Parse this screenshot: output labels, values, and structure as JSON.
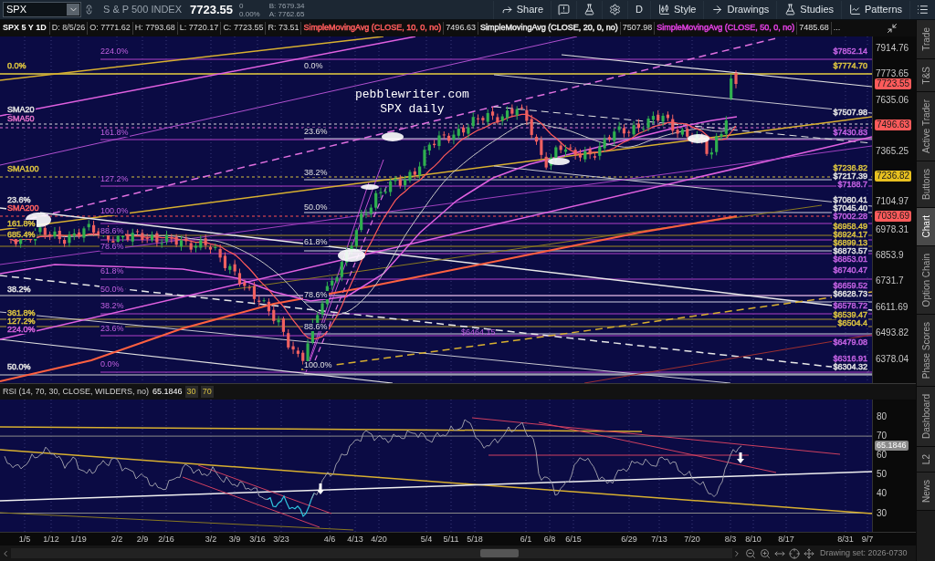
{
  "toolbar": {
    "symbol": "SPX",
    "description": "S & P 500 INDEX",
    "last": "7723.55",
    "change": "0",
    "change_pct": "0.00%",
    "bid": "B: 7679.34",
    "ask": "A: 7762.65",
    "buttons": [
      {
        "kind": "share",
        "label": "Share"
      },
      {
        "kind": "alert"
      },
      {
        "kind": "flask"
      },
      {
        "kind": "gear"
      },
      {
        "kind": "period",
        "label": "D"
      },
      {
        "kind": "style",
        "label": "Style"
      },
      {
        "kind": "drawings",
        "label": "Drawings"
      },
      {
        "kind": "studies",
        "label": "Studies"
      },
      {
        "kind": "patterns",
        "label": "Patterns"
      },
      {
        "kind": "menu"
      }
    ]
  },
  "chart_header": {
    "title": "SPX 5 Y 1D",
    "fields": [
      "D: 8/5/26",
      "O: 7771.62",
      "H: 7793.68",
      "L: 7720.17",
      "C: 7723.55",
      "R: 73.51"
    ],
    "studies": [
      {
        "name": "SimpleMovingAvg (CLOSE, 10, 0, no)",
        "value": "7496.63",
        "color": "#ff5c5c"
      },
      {
        "name": "SimpleMovingAvg (CLOSE, 20, 0, no)",
        "value": "7507.98",
        "color": "#e8e8e8"
      },
      {
        "name": "SimpleMovingAvg (CLOSE, 50, 0, no)",
        "value": "7485.68",
        "color": "#e040e0"
      }
    ],
    "more": "..."
  },
  "price_chart": {
    "note": [
      "pebblewriter.com",
      "SPX daily"
    ],
    "left_labels": [
      {
        "label": "0.0%",
        "color": "#d8c040"
      },
      {
        "label": "SMA20",
        "color": "#e0e0e0"
      },
      {
        "label": "SMA50",
        "color": "#e070c8"
      },
      {
        "label": "SMA100",
        "color": "#d8c040"
      },
      {
        "label": "23.6%",
        "color": "#e0e0e0"
      },
      {
        "label": "SMA200",
        "color": "#ff6060"
      },
      {
        "label": "161.8%",
        "color": "#d8c040"
      },
      {
        "label": "685.4%",
        "color": "#d8c040"
      },
      {
        "label": "38.2%",
        "color": "#e0e0e0"
      },
      {
        "label": "361.8%",
        "color": "#d8c040"
      },
      {
        "label": "127.2%",
        "color": "#d8c040"
      },
      {
        "label": "224.0%",
        "color": "#d060d8"
      },
      {
        "label": "50.0%",
        "color": "#e0e0e0"
      }
    ],
    "extension_labels": [
      "224.0%",
      "161.8%",
      "127.2%",
      "100.0%",
      "88.6%",
      "78.6%",
      "61.8%",
      "50.0%",
      "38.2%",
      "23.6%",
      "0.0%"
    ],
    "retracement_labels": [
      "0.0%",
      "23.6%",
      "38.2%",
      "50.0%",
      "61.8%",
      "78.6%",
      "88.6%",
      "100.0%"
    ],
    "mid_level_label": "$6464.15",
    "level_labels": [
      {
        "label": "$7852.14",
        "color": "#c060e0"
      },
      {
        "label": "$7774.70",
        "color": "#d8c040"
      },
      {
        "label": "$7507.98",
        "color": "#e0e0e0"
      },
      {
        "label": "$7430.83",
        "color": "#c060e0"
      },
      {
        "label": "$7236.82",
        "color": "#d8c040"
      },
      {
        "label": "$7217.39",
        "color": "#e0e0e0"
      },
      {
        "label": "$7188.7",
        "color": "#c060e0"
      },
      {
        "label": "$7080.41",
        "color": "#e0e0e0"
      },
      {
        "label": "$7045.40",
        "color": "#e0e0e0"
      },
      {
        "label": "$7002.28",
        "color": "#c060e0"
      },
      {
        "label": "$6958.49",
        "color": "#d8c040"
      },
      {
        "label": "$6924.17",
        "color": "#d8c040"
      },
      {
        "label": "$6899.13",
        "color": "#d8c040"
      },
      {
        "label": "$6873.57",
        "color": "#e0e0e0"
      },
      {
        "label": "$6853.01",
        "color": "#c060e0"
      },
      {
        "label": "$6740.47",
        "color": "#c060e0"
      },
      {
        "label": "$6659.52",
        "color": "#c060e0"
      },
      {
        "label": "$6628.73",
        "color": "#e0e0e0"
      },
      {
        "label": "$6578.72",
        "color": "#c060e0"
      },
      {
        "label": "$6539.47",
        "color": "#d8c040"
      },
      {
        "label": "$6504.4",
        "color": "#d8c040"
      },
      {
        "label": "$6479.08",
        "color": "#c060e0"
      },
      {
        "label": "$6316.91",
        "color": "#c060e0"
      },
      {
        "label": "$6304.32",
        "color": "#e0e0e0"
      }
    ],
    "axis_ticks": [
      "7914.76",
      "7773.65",
      "7635.06",
      "7365.25",
      "7104.97",
      "6978.31",
      "6853.9",
      "6731.7",
      "6611.69",
      "6493.82",
      "6378.04"
    ],
    "badges": [
      {
        "value": "7723.55",
        "color": "#ff5b5b"
      },
      {
        "value": "7496.63",
        "color": "#ff5b5b"
      },
      {
        "value": "7236.82",
        "color": "#e8c020"
      },
      {
        "value": "7039.69",
        "color": "#ff5b5b"
      }
    ]
  },
  "rsi": {
    "title": "RSI (14, 70, 30, CLOSE, WILDERS, no)",
    "value": "65.1846",
    "levels": [
      "30",
      "70"
    ],
    "axis_ticks": [
      "80",
      "70",
      "60",
      "50",
      "40",
      "30"
    ],
    "badge": "65.1846"
  },
  "dates": [
    "1/5",
    "1/12",
    "1/19",
    "2/2",
    "2/9",
    "2/16",
    "3/2",
    "3/9",
    "3/16",
    "3/23",
    "4/6",
    "4/13",
    "4/20",
    "5/4",
    "5/11",
    "5/18",
    "6/1",
    "6/8",
    "6/15",
    "6/29",
    "7/13",
    "7/20",
    "8/3",
    "8/10",
    "8/17",
    "8/31",
    "9/7"
  ],
  "side_tabs": [
    {
      "label": "Trade",
      "selected": false
    },
    {
      "label": "T&S",
      "selected": false
    },
    {
      "label": "Active Trader",
      "selected": false
    },
    {
      "label": "Buttons",
      "selected": false
    },
    {
      "label": "Chart",
      "selected": true
    },
    {
      "label": "Option Chain",
      "selected": false
    },
    {
      "label": "Phase Scores",
      "selected": false
    },
    {
      "label": "Dashboard",
      "selected": false
    },
    {
      "label": "L2",
      "selected": false
    },
    {
      "label": "News",
      "selected": false
    }
  ],
  "status_bar": {
    "drawing_set": "Drawing set: 2026-0730"
  }
}
